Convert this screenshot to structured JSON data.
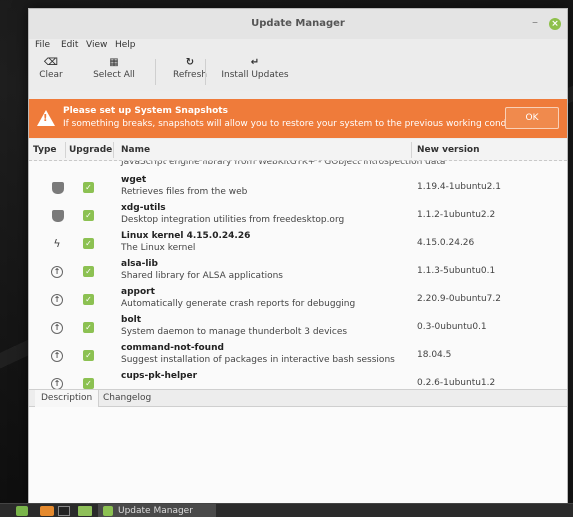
{
  "window": {
    "title": "Update Manager"
  },
  "menu": [
    "File",
    "Edit",
    "View",
    "Help"
  ],
  "toolbar": {
    "clear": "Clear",
    "select_all": "Select All",
    "refresh": "Refresh",
    "install": "Install Updates"
  },
  "banner": {
    "title": "Please set up System Snapshots",
    "text": "If something breaks, snapshots will allow you to restore your system to the previous working condition.",
    "ok": "OK",
    "color": "#ef7b3a"
  },
  "columns": {
    "type": "Type",
    "upgrade": "Upgrade",
    "name": "Name",
    "version": "New version"
  },
  "partial_row": "JavaScript engine library from WebKitGTK+ - GObject introspection data",
  "packages": [
    {
      "type_icon": "shield-icon",
      "name": "wget",
      "desc": "Retrieves files from the web",
      "version": "1.19.4-1ubuntu2.1"
    },
    {
      "type_icon": "shield-icon",
      "name": "xdg-utils",
      "desc": "Desktop integration utilities from freedesktop.org",
      "version": "1.1.2-1ubuntu2.2"
    },
    {
      "type_icon": "kernel-bolt-icon",
      "name": "Linux kernel 4.15.0.24.26",
      "desc": "The Linux kernel",
      "version": "4.15.0.24.26"
    },
    {
      "type_icon": "upgrade-arrow-icon",
      "name": "alsa-lib",
      "desc": "Shared library for ALSA applications",
      "version": "1.1.3-5ubuntu0.1"
    },
    {
      "type_icon": "upgrade-arrow-icon",
      "name": "apport",
      "desc": "Automatically generate crash reports for debugging",
      "version": "2.20.9-0ubuntu7.2"
    },
    {
      "type_icon": "upgrade-arrow-icon",
      "name": "bolt",
      "desc": "System daemon to manage thunderbolt 3 devices",
      "version": "0.3-0ubuntu0.1"
    },
    {
      "type_icon": "upgrade-arrow-icon",
      "name": "command-not-found",
      "desc": "Suggest installation of packages in interactive bash sessions",
      "version": "18.04.5"
    },
    {
      "type_icon": "upgrade-arrow-icon",
      "name": "cups-pk-helper",
      "desc": "",
      "version": "0.2.6-1ubuntu1.2"
    }
  ],
  "tabs": [
    "Description",
    "Changelog"
  ],
  "taskbar": {
    "window_label": "Update Manager"
  }
}
